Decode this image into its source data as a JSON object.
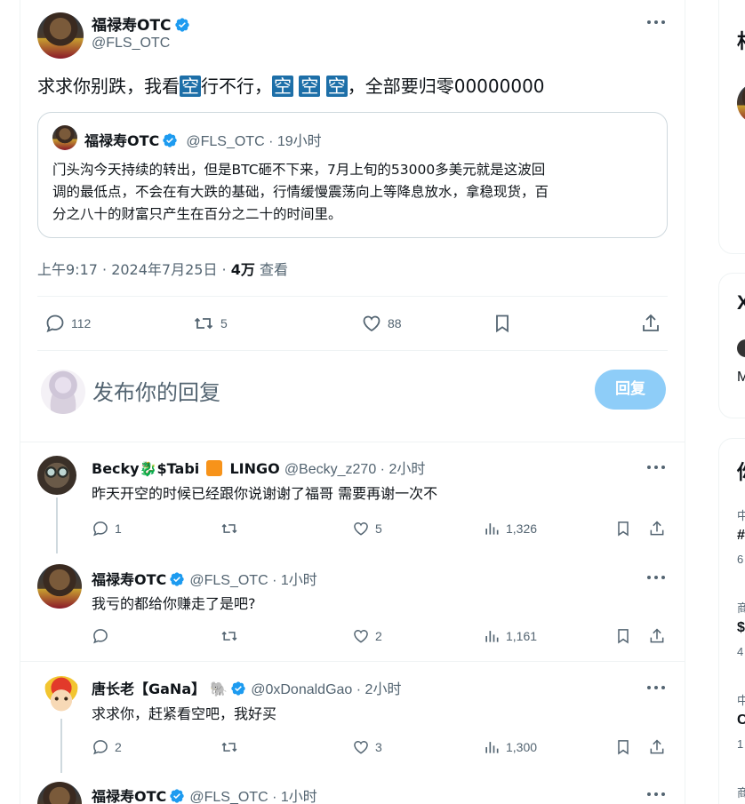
{
  "main_tweet": {
    "author_name": "福禄寿OTC",
    "handle": "@FLS_OTC",
    "text_parts": [
      "求求你别跌，我看",
      "空",
      "行不行，",
      "空",
      "空",
      "空",
      "，全部要归零00000000"
    ],
    "quote": {
      "author_name": "福禄寿OTC",
      "meta": "@FLS_OTC · 19小时",
      "lines": [
        "门头沟今天持续的转出，但是BTC砸不下来，7月上旬的53000多美元就是这波回",
        "调的最低点，不会在有大跌的基础，行情缓慢震荡向上等降息放水，拿稳现货，百",
        "分之八十的财富只产生在百分之二十的时间里。"
      ]
    },
    "timestamp": "上午9:17 · 2024年7月25日 · ",
    "views_count": "4万",
    "views_label": " 查看",
    "stats": {
      "replies": "112",
      "retweets": "5",
      "likes": "88"
    }
  },
  "composer": {
    "placeholder": "发布你的回复",
    "reply_button": "回复"
  },
  "replies": [
    {
      "name_parts": [
        "Becky",
        "$Tabi",
        "LINGO"
      ],
      "meta": "@Becky_z270 · 2小时",
      "text": "昨天开空的时候已经跟你说谢谢了福哥  需要再谢一次不",
      "replies": "1",
      "retweets": "",
      "likes": "5",
      "views": "1,326"
    },
    {
      "name": "福禄寿OTC",
      "meta": "@FLS_OTC · 1小时",
      "text": "我亏的都给你赚走了是吧?",
      "replies": "",
      "retweets": "",
      "likes": "2",
      "views": "1,161"
    },
    {
      "name": "唐长老【GaNa】",
      "meta": "@0xDonaldGao · 2小时",
      "text": "求求你，赶紧看空吧，我好买",
      "replies": "2",
      "retweets": "",
      "likes": "3",
      "views": "1,300"
    },
    {
      "name": "福禄寿OTC",
      "meta": "@FLS_OTC · 1小时"
    }
  ],
  "sidebar": {
    "box1_title": "相",
    "box2_title": "X",
    "box2_line": "M",
    "box3_title": "你",
    "trend_texts": [
      "中",
      "#",
      "6",
      "商",
      "$",
      "4",
      "中",
      "C",
      "1",
      "商"
    ]
  },
  "colors": {
    "accent": "#1d9bf0",
    "reply_button": "#8ecdf8",
    "verified": "#1d9bf0",
    "highlight": "#1d6fa8"
  }
}
